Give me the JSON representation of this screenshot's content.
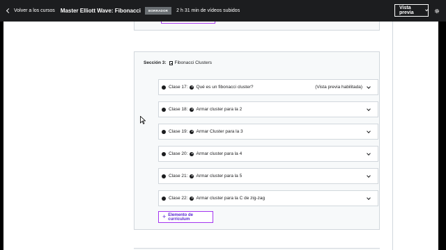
{
  "topbar": {
    "back_label": "Volver a los cursos",
    "course_title": "Master Elliott Wave: Fibonacci",
    "status_badge": "BORRADOR",
    "uploaded_info": "2 h 31 min de vídeos subidos",
    "preview_label": "Vista previa"
  },
  "section": {
    "label": "Sección 3:",
    "title": "Fibonacci Clusters",
    "lectures": [
      {
        "number": "Clase 17:",
        "title": "Qué es un fibonacci cluster?",
        "tag": "(Vista previa habilitada)"
      },
      {
        "number": "Clase 18:",
        "title": "Armar cluster para la 2",
        "tag": ""
      },
      {
        "number": "Clase 19:",
        "title": "Armar Cluster para la 3",
        "tag": ""
      },
      {
        "number": "Clase 20:",
        "title": "Armar cluster para la 4",
        "tag": ""
      },
      {
        "number": "Clase 21:",
        "title": "Armar cluster para la 5",
        "tag": ""
      },
      {
        "number": "Clase 22:",
        "title": "Armar cluster para la C de zig-zag",
        "tag": ""
      }
    ],
    "add_label": "Elemento de currículum"
  },
  "icons": {
    "back": "chevron-left-icon",
    "settings": "gear-icon",
    "section": "document-icon",
    "check": "check-circle-icon",
    "play": "play-circle-icon",
    "expand": "chevron-down-icon"
  },
  "colors": {
    "topbar_bg": "#1c1d1f",
    "accent": "#a435f0",
    "link": "#5624d0",
    "section_bg": "#f7f9fa",
    "border": "#d1d7dc"
  }
}
